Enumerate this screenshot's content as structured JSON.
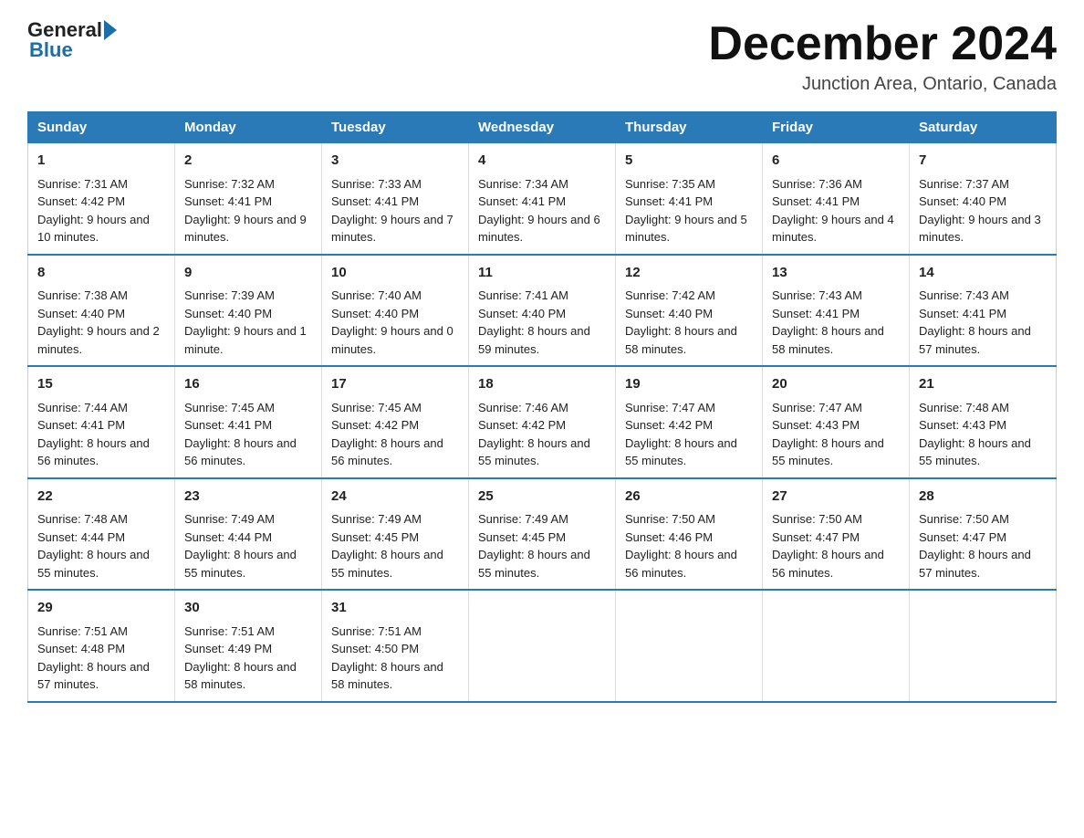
{
  "header": {
    "logo_general": "General",
    "logo_blue": "Blue",
    "month_title": "December 2024",
    "location": "Junction Area, Ontario, Canada"
  },
  "days_of_week": [
    "Sunday",
    "Monday",
    "Tuesday",
    "Wednesday",
    "Thursday",
    "Friday",
    "Saturday"
  ],
  "weeks": [
    [
      {
        "day": "1",
        "sunrise": "7:31 AM",
        "sunset": "4:42 PM",
        "daylight": "9 hours and 10 minutes."
      },
      {
        "day": "2",
        "sunrise": "7:32 AM",
        "sunset": "4:41 PM",
        "daylight": "9 hours and 9 minutes."
      },
      {
        "day": "3",
        "sunrise": "7:33 AM",
        "sunset": "4:41 PM",
        "daylight": "9 hours and 7 minutes."
      },
      {
        "day": "4",
        "sunrise": "7:34 AM",
        "sunset": "4:41 PM",
        "daylight": "9 hours and 6 minutes."
      },
      {
        "day": "5",
        "sunrise": "7:35 AM",
        "sunset": "4:41 PM",
        "daylight": "9 hours and 5 minutes."
      },
      {
        "day": "6",
        "sunrise": "7:36 AM",
        "sunset": "4:41 PM",
        "daylight": "9 hours and 4 minutes."
      },
      {
        "day": "7",
        "sunrise": "7:37 AM",
        "sunset": "4:40 PM",
        "daylight": "9 hours and 3 minutes."
      }
    ],
    [
      {
        "day": "8",
        "sunrise": "7:38 AM",
        "sunset": "4:40 PM",
        "daylight": "9 hours and 2 minutes."
      },
      {
        "day": "9",
        "sunrise": "7:39 AM",
        "sunset": "4:40 PM",
        "daylight": "9 hours and 1 minute."
      },
      {
        "day": "10",
        "sunrise": "7:40 AM",
        "sunset": "4:40 PM",
        "daylight": "9 hours and 0 minutes."
      },
      {
        "day": "11",
        "sunrise": "7:41 AM",
        "sunset": "4:40 PM",
        "daylight": "8 hours and 59 minutes."
      },
      {
        "day": "12",
        "sunrise": "7:42 AM",
        "sunset": "4:40 PM",
        "daylight": "8 hours and 58 minutes."
      },
      {
        "day": "13",
        "sunrise": "7:43 AM",
        "sunset": "4:41 PM",
        "daylight": "8 hours and 58 minutes."
      },
      {
        "day": "14",
        "sunrise": "7:43 AM",
        "sunset": "4:41 PM",
        "daylight": "8 hours and 57 minutes."
      }
    ],
    [
      {
        "day": "15",
        "sunrise": "7:44 AM",
        "sunset": "4:41 PM",
        "daylight": "8 hours and 56 minutes."
      },
      {
        "day": "16",
        "sunrise": "7:45 AM",
        "sunset": "4:41 PM",
        "daylight": "8 hours and 56 minutes."
      },
      {
        "day": "17",
        "sunrise": "7:45 AM",
        "sunset": "4:42 PM",
        "daylight": "8 hours and 56 minutes."
      },
      {
        "day": "18",
        "sunrise": "7:46 AM",
        "sunset": "4:42 PM",
        "daylight": "8 hours and 55 minutes."
      },
      {
        "day": "19",
        "sunrise": "7:47 AM",
        "sunset": "4:42 PM",
        "daylight": "8 hours and 55 minutes."
      },
      {
        "day": "20",
        "sunrise": "7:47 AM",
        "sunset": "4:43 PM",
        "daylight": "8 hours and 55 minutes."
      },
      {
        "day": "21",
        "sunrise": "7:48 AM",
        "sunset": "4:43 PM",
        "daylight": "8 hours and 55 minutes."
      }
    ],
    [
      {
        "day": "22",
        "sunrise": "7:48 AM",
        "sunset": "4:44 PM",
        "daylight": "8 hours and 55 minutes."
      },
      {
        "day": "23",
        "sunrise": "7:49 AM",
        "sunset": "4:44 PM",
        "daylight": "8 hours and 55 minutes."
      },
      {
        "day": "24",
        "sunrise": "7:49 AM",
        "sunset": "4:45 PM",
        "daylight": "8 hours and 55 minutes."
      },
      {
        "day": "25",
        "sunrise": "7:49 AM",
        "sunset": "4:45 PM",
        "daylight": "8 hours and 55 minutes."
      },
      {
        "day": "26",
        "sunrise": "7:50 AM",
        "sunset": "4:46 PM",
        "daylight": "8 hours and 56 minutes."
      },
      {
        "day": "27",
        "sunrise": "7:50 AM",
        "sunset": "4:47 PM",
        "daylight": "8 hours and 56 minutes."
      },
      {
        "day": "28",
        "sunrise": "7:50 AM",
        "sunset": "4:47 PM",
        "daylight": "8 hours and 57 minutes."
      }
    ],
    [
      {
        "day": "29",
        "sunrise": "7:51 AM",
        "sunset": "4:48 PM",
        "daylight": "8 hours and 57 minutes."
      },
      {
        "day": "30",
        "sunrise": "7:51 AM",
        "sunset": "4:49 PM",
        "daylight": "8 hours and 58 minutes."
      },
      {
        "day": "31",
        "sunrise": "7:51 AM",
        "sunset": "4:50 PM",
        "daylight": "8 hours and 58 minutes."
      },
      null,
      null,
      null,
      null
    ]
  ]
}
